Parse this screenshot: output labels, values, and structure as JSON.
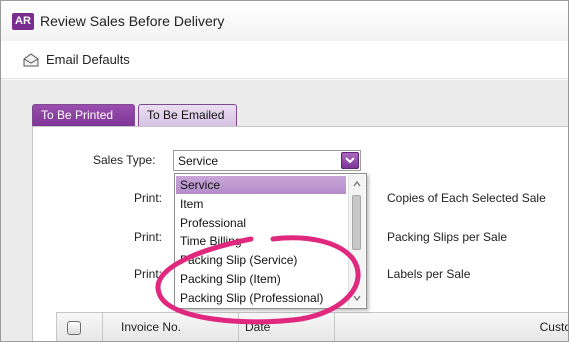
{
  "window": {
    "app_logo": "AR",
    "title": "Review Sales Before Delivery"
  },
  "toolbar": {
    "email_defaults_label": "Email Defaults",
    "email_icon": "envelope-icon"
  },
  "tabs": [
    {
      "label": "To Be Printed",
      "active": true
    },
    {
      "label": "To Be Emailed",
      "active": false
    }
  ],
  "form": {
    "sales_type_label": "Sales Type:",
    "sales_type_value": "Service",
    "print_label": "Print:",
    "copies_label": "Copies of Each Selected Sale",
    "packing_slips_label": "Packing Slips per Sale",
    "labels_label": "Labels per Sale"
  },
  "dropdown": {
    "options": [
      "Service",
      "Item",
      "Professional",
      "Time Billing",
      "Packing Slip (Service)",
      "Packing Slip (Item)",
      "Packing Slip (Professional)"
    ],
    "selected": "Service"
  },
  "grid": {
    "columns": [
      "Invoice No.",
      "Date",
      "Custo"
    ]
  },
  "colors": {
    "accent": "#7e3595",
    "tab_active": "#8a40a3",
    "tab_inactive": "#dcc8e6",
    "highlight_pen": "#e0287f"
  }
}
